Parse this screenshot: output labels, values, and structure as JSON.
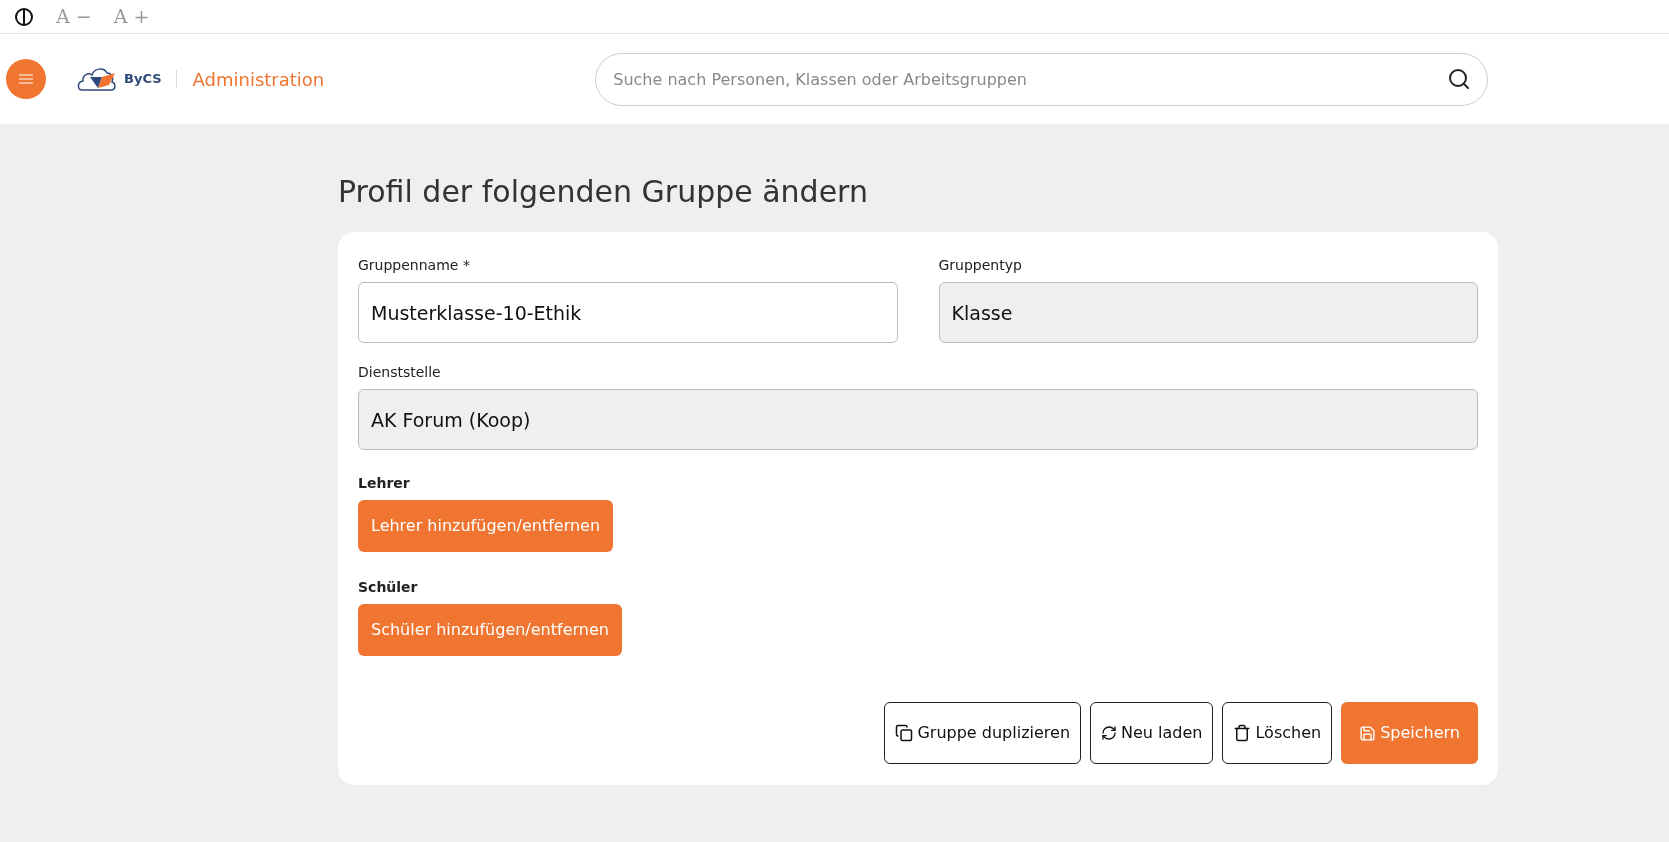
{
  "accessibility_bar": {
    "font_smaller": "A −",
    "font_larger": "A +"
  },
  "header": {
    "logo_text": "ByCS",
    "app_title": "Administration",
    "search": {
      "placeholder": "Suche nach Personen, Klassen oder Arbeitsgruppen"
    }
  },
  "page_title": "Profil der folgenden Gruppe ändern",
  "form": {
    "rows": [
      {
        "fields": [
          {
            "label": "Gruppenname *",
            "value": "Musterklasse-10-Ethik",
            "disabled": false
          },
          {
            "label": "Gruppentyp",
            "value": "Klasse",
            "disabled": true
          }
        ]
      },
      {
        "fields": [
          {
            "label": "Dienststelle",
            "value": "AK Forum (Koop)",
            "disabled": true
          }
        ]
      }
    ],
    "member_sections": [
      {
        "label": "Lehrer",
        "button": "Lehrer hinzufügen/entfernen"
      },
      {
        "label": "Schüler",
        "button": "Schüler hinzufügen/entfernen"
      }
    ],
    "actions": [
      {
        "label": "Gruppe duplizieren",
        "primary": false
      },
      {
        "label": "Neu laden",
        "primary": false
      },
      {
        "label": "Löschen",
        "primary": false
      },
      {
        "label": "Speichern",
        "primary": true
      }
    ]
  }
}
